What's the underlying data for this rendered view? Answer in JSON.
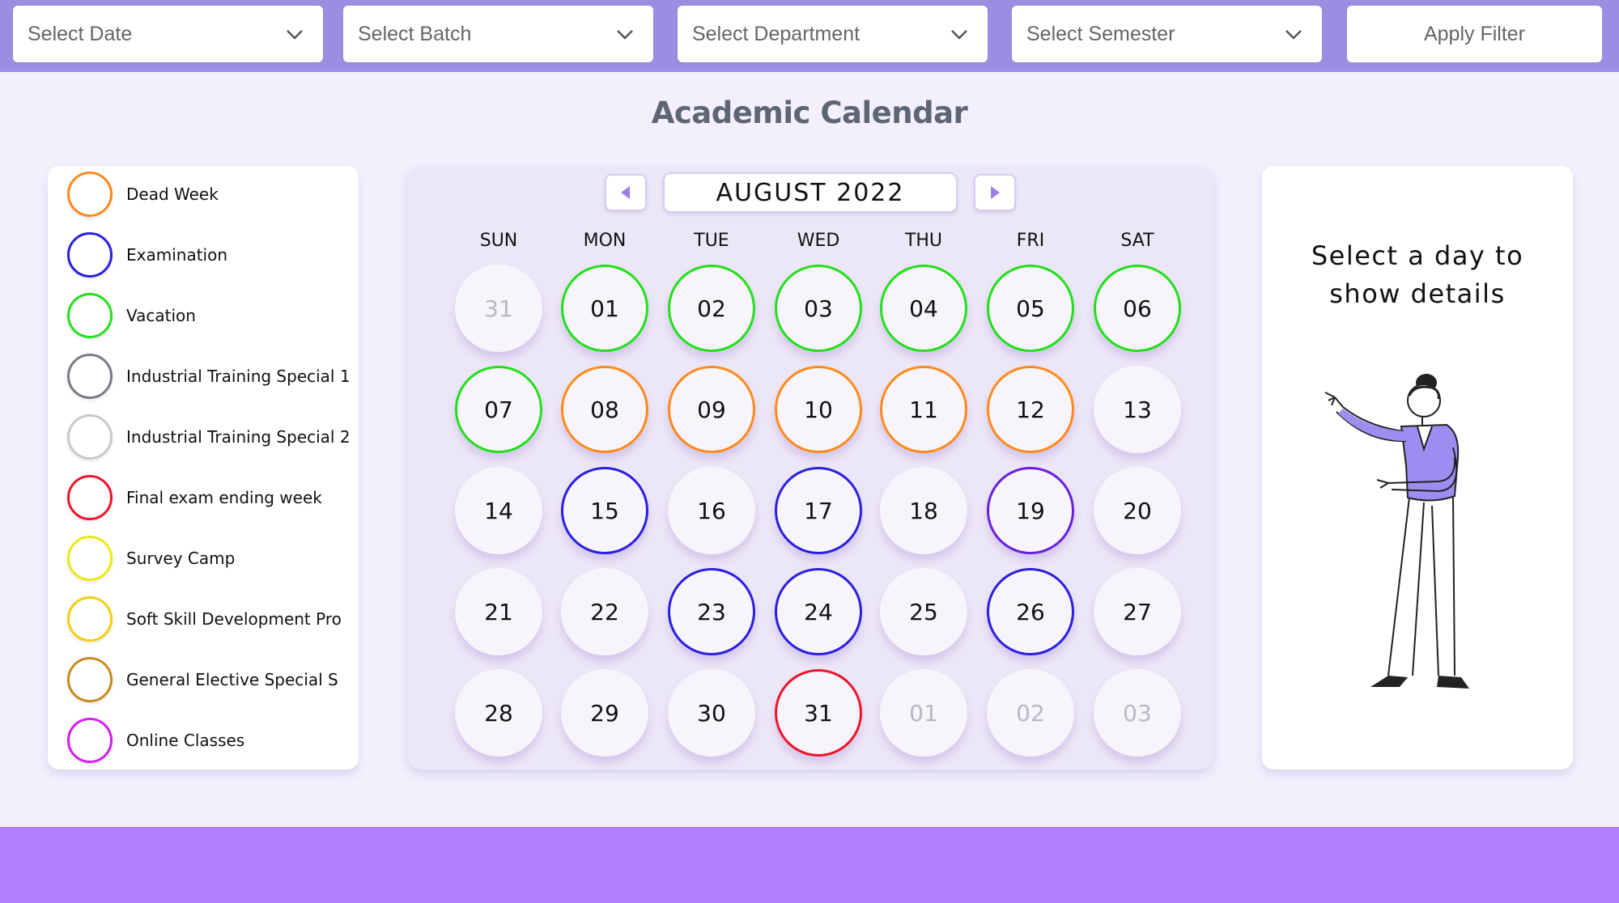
{
  "filters": {
    "date": "Select Date",
    "batch": "Select Batch",
    "department": "Select Department",
    "semester": "Select Semester",
    "apply": "Apply Filter"
  },
  "page_title": "Academic Calendar",
  "legend": [
    {
      "label": "Dead Week",
      "color": "#ff8a1c"
    },
    {
      "label": "Examination",
      "color": "#2b1fe0"
    },
    {
      "label": "Vacation",
      "color": "#22e01c"
    },
    {
      "label": "Industrial Training Special 1",
      "color": "#7a7a86"
    },
    {
      "label": "Industrial Training Special 2",
      "color": "#c8c8cf"
    },
    {
      "label": "Final exam ending week",
      "color": "#f0132a"
    },
    {
      "label": "Survey Camp",
      "color": "#ecea12"
    },
    {
      "label": "Soft Skill Development Pro",
      "color": "#f5cf0e"
    },
    {
      "label": "General Elective Special S",
      "color": "#c98a1e"
    },
    {
      "label": "Online Classes",
      "color": "#d41ef2"
    }
  ],
  "calendar": {
    "month_year": "AUGUST  2022",
    "weekdays": [
      "SUN",
      "MON",
      "TUE",
      "WED",
      "THU",
      "FRI",
      "SAT"
    ],
    "weeks": [
      [
        {
          "d": "31",
          "muted": true
        },
        {
          "d": "01",
          "c": "#22e01c"
        },
        {
          "d": "02",
          "c": "#22e01c"
        },
        {
          "d": "03",
          "c": "#22e01c"
        },
        {
          "d": "04",
          "c": "#22e01c"
        },
        {
          "d": "05",
          "c": "#22e01c"
        },
        {
          "d": "06",
          "c": "#22e01c"
        }
      ],
      [
        {
          "d": "07",
          "c": "#22e01c"
        },
        {
          "d": "08",
          "c": "#ff8a1c"
        },
        {
          "d": "09",
          "c": "#ff8a1c"
        },
        {
          "d": "10",
          "c": "#ff8a1c"
        },
        {
          "d": "11",
          "c": "#ff8a1c"
        },
        {
          "d": "12",
          "c": "#ff8a1c"
        },
        {
          "d": "13"
        }
      ],
      [
        {
          "d": "14"
        },
        {
          "d": "15",
          "c": "#2b1fe0"
        },
        {
          "d": "16"
        },
        {
          "d": "17",
          "c": "#2b1fe0"
        },
        {
          "d": "18"
        },
        {
          "d": "19",
          "c": "#6a1fe0"
        },
        {
          "d": "20"
        }
      ],
      [
        {
          "d": "21"
        },
        {
          "d": "22"
        },
        {
          "d": "23",
          "c": "#2b1fe0"
        },
        {
          "d": "24",
          "c": "#2b1fe0"
        },
        {
          "d": "25"
        },
        {
          "d": "26",
          "c": "#2b1fe0"
        },
        {
          "d": "27"
        }
      ],
      [
        {
          "d": "28"
        },
        {
          "d": "29"
        },
        {
          "d": "30"
        },
        {
          "d": "31",
          "c": "#f0132a"
        },
        {
          "d": "01",
          "muted": true
        },
        {
          "d": "02",
          "muted": true
        },
        {
          "d": "03",
          "muted": true
        }
      ]
    ]
  },
  "details": {
    "prompt": "Select a day to show details"
  },
  "colors": {
    "topbar": "#9b8ee0",
    "footer": "#b07ffb",
    "accent_nav": "#9b7fe6"
  }
}
